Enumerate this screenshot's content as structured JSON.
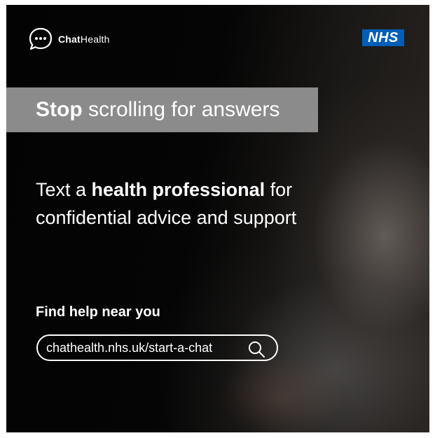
{
  "brand": {
    "name_bold": "Chat",
    "name_regular": "Health",
    "partner_logo": "NHS",
    "colors": {
      "nhs_blue": "#005eb8",
      "banner_grey": "#8b8b8b"
    }
  },
  "headline": {
    "bold": "Stop",
    "rest": " scrolling for answers"
  },
  "body": {
    "prefix": "Text a ",
    "bold": "health professional",
    "suffix": " for confidential advice and support"
  },
  "cta": {
    "heading": "Find help near you",
    "url": "chathealth.nhs.uk/start-a-chat",
    "icon": "search-icon"
  }
}
